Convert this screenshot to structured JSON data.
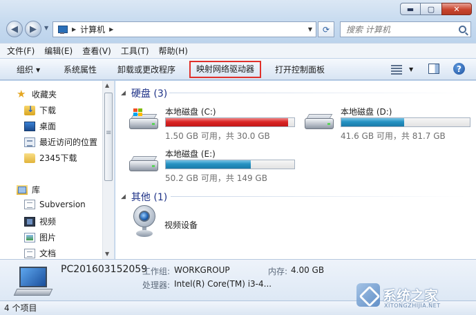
{
  "window": {
    "controls": {
      "minimize": "▬",
      "maximize": "▢",
      "close": "✕"
    }
  },
  "address": {
    "crumb": "计算机",
    "search_placeholder": "搜索 计算机"
  },
  "menu": [
    "文件(F)",
    "编辑(E)",
    "查看(V)",
    "工具(T)",
    "帮助(H)"
  ],
  "commands": {
    "organize": "组织",
    "system_properties": "系统属性",
    "uninstall": "卸载或更改程序",
    "map_drive": "映射网络驱动器",
    "control_panel": "打开控制面板"
  },
  "nav": {
    "favorites": "收藏夹",
    "downloads": "下载",
    "desktop": "桌面",
    "recent": "最近访问的位置",
    "downloads2345": "2345下载",
    "libraries": "库",
    "subversion": "Subversion",
    "videos": "视频",
    "pictures": "图片",
    "documents": "文档"
  },
  "sections": {
    "hdd_title": "硬盘 (3)",
    "other_title": "其他 (1)"
  },
  "drives": [
    {
      "name": "本地磁盘 (C:)",
      "caption": "1.50 GB 可用，共 30.0 GB",
      "used_fraction": 0.95,
      "color": "#c21717"
    },
    {
      "name": "本地磁盘 (D:)",
      "caption": "41.6 GB 可用，共 81.7 GB",
      "used_fraction": 0.49,
      "color": "#1a7aa8"
    },
    {
      "name": "本地磁盘 (E:)",
      "caption": "50.2 GB 可用，共 149 GB",
      "used_fraction": 0.66,
      "color": "#1a7aa8"
    }
  ],
  "other": {
    "webcam": "视频设备"
  },
  "details": {
    "pc_name": "PC201603152059",
    "workgroup_label": "工作组:",
    "workgroup": "WORKGROUP",
    "memory_label": "内存:",
    "memory": "4.00 GB",
    "cpu_label": "处理器:",
    "cpu": "Intel(R) Core(TM) i3-4..."
  },
  "status": {
    "count": "4 个项目"
  },
  "watermark": {
    "text": "系统之家",
    "sub": "XITONGZHIJIA.NET"
  },
  "colors": {
    "highlight_border": "#e0302a",
    "section_title": "#1e3287"
  }
}
